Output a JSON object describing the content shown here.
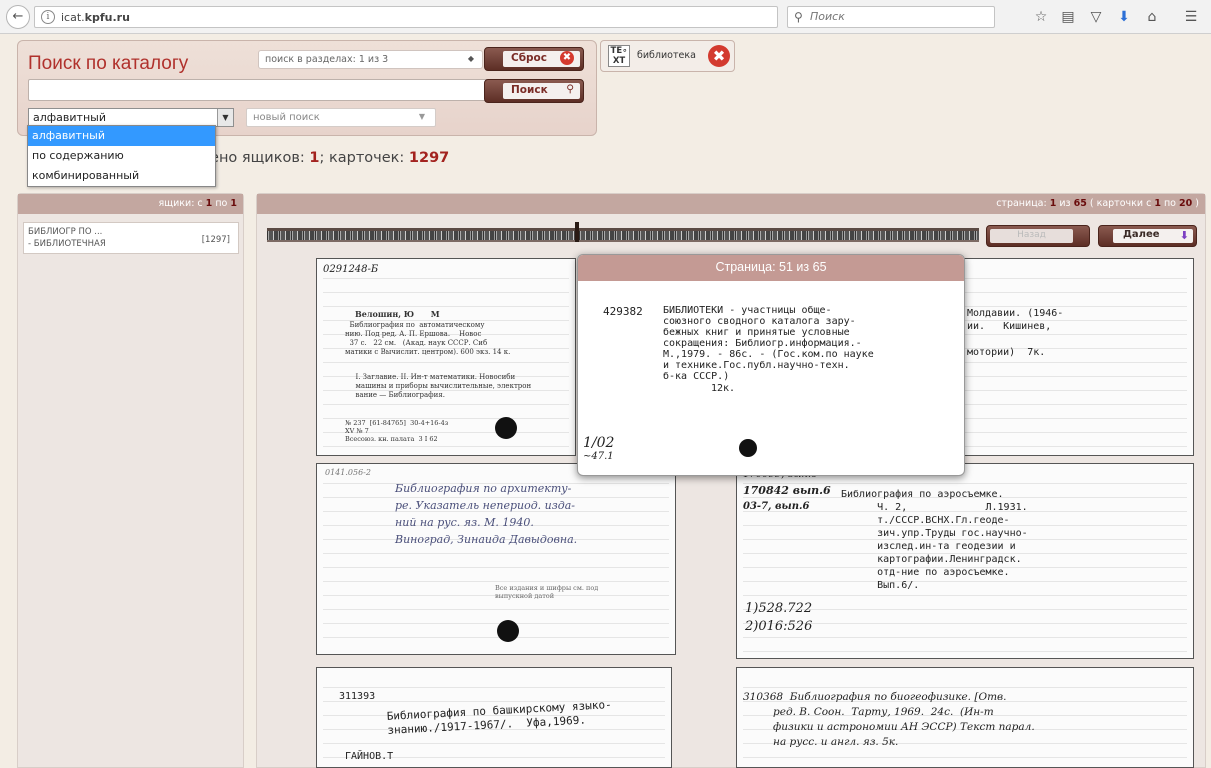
{
  "browser": {
    "url_host": "icat.",
    "url_domain": "kpfu.ru",
    "search_placeholder": "Поиск"
  },
  "search_panel": {
    "title": "Поиск по каталогу",
    "sections_select": "поиск в разделах: 1 из 3",
    "reset_label": "Сброс",
    "search_label": "Поиск",
    "query_value": "",
    "mode_select": "алфавитный",
    "history_select": "новый поиск",
    "mode_options": [
      "алфавитный",
      "по содержанию",
      "комбинированный"
    ]
  },
  "text_toggle": {
    "icon_text_top": "TE∘",
    "icon_text_bottom": "XT",
    "label": "библиотека"
  },
  "found": {
    "prefix": "дено ящиков: ",
    "boxes": "1",
    "sep": "; карточек: ",
    "cards": "1297"
  },
  "left_pane": {
    "header_prefix": "ящики: с ",
    "header_from": "1",
    "header_mid": " по ",
    "header_to": "1",
    "box_line1": "БИБЛИОГР ПО ...",
    "box_line2": "- БИБЛИОТЕЧНАЯ",
    "box_count": "[1297]"
  },
  "right_pane": {
    "header_prefix": "страница: ",
    "page": "1",
    "header_of": " из ",
    "pages": "65",
    "header_cards": " ( карточки с ",
    "cards_from": "1",
    "cards_by": " по ",
    "cards_to": "20",
    "header_end": " )",
    "prev_label": "Назад",
    "next_label": "Далее"
  },
  "popup": {
    "title": "Страница: 51 из 65",
    "card_number": "429382",
    "card_text": "БИБЛИОТЕКИ - участницы обще-\nсоюзного сводного каталога зару-\nбежных книг и принятые условные\nсокращения: Библиогр.информация.-\nМ.,1979. - 86с. - (Гос.ком.по науке\nи технике.Гос.публ.научно-техн.\nб-ка СССР.)",
    "copies": "12к.",
    "note": "1/02",
    "note2": "~47.1"
  },
  "cards": {
    "c1_num": "0291248-Б",
    "c1_author": "Велошин, Ю      М",
    "c1_text": "  Библиография по  автоматическому\nнию. Под ред. А. П. Ершова.    Новос\n  37 с.   22 см.   (Акад. наук СССР. Сиб\nматики с Вычислит. центром). 600 экз. 14 к.",
    "c1_sub": "  I. Заглавие. II. Ин-т математики. Новосиби\n  машины и приборы вычислительные, электрон\n  вание — Библиография.",
    "c1_foot": "№ 237  [61-84765]  30-4+16-4з\nXV № 7\nВсесоюз. кн. палата  3 I 62",
    "c2_num": "0141.056-2",
    "c2_text": "Библиография по архитекту-\nре. Указатель непериод. изда-\nний на рус. яз. М. 1940.\nВиноград, Зинаида Давыдовна.",
    "c2_stamp": "Все издания и шифры см. под\nвыпускной датой",
    "c3_top": "170099, вып.6",
    "c3_num1": "170842 вып.6",
    "c3_num2": "03-7, вып.6",
    "c3_text": "Библиография по аэросъемке.\n      Ч. 2,             Л.1931.\n      т./СССР.ВСНХ.Гл.геоде-\n      зич.упр.Труды гос.научно-\n      изслед.ин-та геодезии и\n      картографии.Ленинградск.\n      отд-ние по аэросъемке.\n      Вып.6/.",
    "c3_foot1": "1)528.722",
    "c3_foot2": "2)016:526",
    "c4_num": "311393",
    "c4_text": "Библиография по башкирскому языко-\nзнанию./1917-1967/.  Уфа,1969.",
    "c4_author": "ГАЙНОВ.Т",
    "c5_text": "310368  Библиография по биогеофизике. [Отв.\n         ред. В. Соон.  Тарту, 1969.  24с.  (Ин-т\n         физики и астрономии АН ЭССР) Текст парал.\n         на русс. и англ. яз. 5к.",
    "c6_right": "Молдавии. (1946-\nии.   Кишинев,\n\nмотории)  7к."
  }
}
